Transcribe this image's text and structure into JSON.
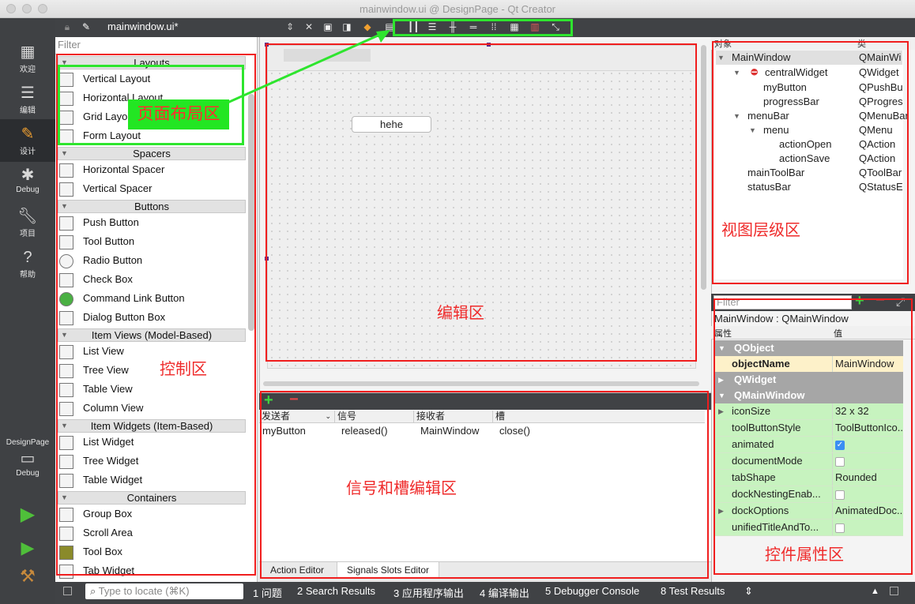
{
  "window": {
    "title": "mainwindow.ui @ DesignPage - Qt Creator"
  },
  "modes": [
    {
      "label": "欢迎",
      "icon": "grid-icon"
    },
    {
      "label": "编辑",
      "icon": "document-icon"
    },
    {
      "label": "设计",
      "icon": "pencil-icon"
    },
    {
      "label": "Debug",
      "icon": "bug-icon"
    },
    {
      "label": "项目",
      "icon": "wrench-icon"
    },
    {
      "label": "帮助",
      "icon": "help-icon"
    }
  ],
  "kit": {
    "project": "DesignPage",
    "config": "Debug"
  },
  "toolbar": {
    "filename": "mainwindow.ui*"
  },
  "widgetbox": {
    "filter_placeholder": "Filter",
    "categories": [
      "Layouts",
      "Spacers",
      "Buttons",
      "Item Views (Model-Based)",
      "Item Widgets (Item-Based)",
      "Containers"
    ],
    "items": {
      "layouts": [
        "Vertical Layout",
        "Horizontal Layout",
        "Grid Layout",
        "Form Layout"
      ],
      "spacers": [
        "Horizontal Spacer",
        "Vertical Spacer"
      ],
      "buttons": [
        "Push Button",
        "Tool Button",
        "Radio Button",
        "Check Box",
        "Command Link Button",
        "Dialog Button Box"
      ],
      "itemviews": [
        "List View",
        "Tree View",
        "Table View",
        "Column View"
      ],
      "itemwidgets": [
        "List Widget",
        "Tree Widget",
        "Table Widget"
      ],
      "containers": [
        "Group Box",
        "Scroll Area",
        "Tool Box",
        "Tab Widget"
      ]
    }
  },
  "form": {
    "button_text": "hehe"
  },
  "signals_slots": {
    "headers": [
      "发送者",
      "信号",
      "接收者",
      "槽"
    ],
    "rows": [
      [
        "myButton",
        "released()",
        "MainWindow",
        "close()"
      ]
    ],
    "tabs": [
      "Action Editor",
      "Signals  Slots Editor"
    ]
  },
  "object_inspector": {
    "headers": [
      "对象",
      "类"
    ],
    "rows": [
      {
        "name": "MainWindow",
        "class": "QMainWi"
      },
      {
        "name": "centralWidget",
        "class": "QWidget"
      },
      {
        "name": "myButton",
        "class": "QPushBu"
      },
      {
        "name": "progressBar",
        "class": "QProgres"
      },
      {
        "name": "menuBar",
        "class": "QMenuBar"
      },
      {
        "name": "menu",
        "class": "QMenu"
      },
      {
        "name": "actionOpen",
        "class": "QAction"
      },
      {
        "name": "actionSave",
        "class": "QAction"
      },
      {
        "name": "mainToolBar",
        "class": "QToolBar"
      },
      {
        "name": "statusBar",
        "class": "QStatusE"
      }
    ]
  },
  "property_editor": {
    "filter_placeholder": "Filter",
    "context": "MainWindow : QMainWindow",
    "headers": [
      "属性",
      "值"
    ],
    "rows": [
      {
        "name": "QObject",
        "value": ""
      },
      {
        "name": "objectName",
        "value": "MainWindow"
      },
      {
        "name": "QWidget",
        "value": ""
      },
      {
        "name": "QMainWindow",
        "value": ""
      },
      {
        "name": "iconSize",
        "value": "32 x 32"
      },
      {
        "name": "toolButtonStyle",
        "value": "ToolButtonIco..."
      },
      {
        "name": "animated",
        "value": "checked"
      },
      {
        "name": "documentMode",
        "value": "unchecked"
      },
      {
        "name": "tabShape",
        "value": "Rounded"
      },
      {
        "name": "dockNestingEnab...",
        "value": "unchecked"
      },
      {
        "name": "dockOptions",
        "value": "AnimatedDoc..."
      },
      {
        "name": "unifiedTitleAndTo...",
        "value": "unchecked"
      }
    ]
  },
  "statusbar": {
    "locate_placeholder": "Type to locate (⌘K)",
    "panes": [
      "1  问题",
      "2  Search Results",
      "3  应用程序输出",
      "4  编译输出",
      "5  Debugger Console",
      "8  Test Results"
    ]
  },
  "annotations": {
    "layout": "页面布局区",
    "widgets": "控制区",
    "editor": "编辑区",
    "signals": "信号和槽编辑区",
    "objects": "视图层级区",
    "properties": "控件属性区"
  },
  "colors": {
    "annotation_red": "#f01e1e",
    "annotation_green": "#2ee52e",
    "prop_highlight": "#c7f3bf"
  }
}
